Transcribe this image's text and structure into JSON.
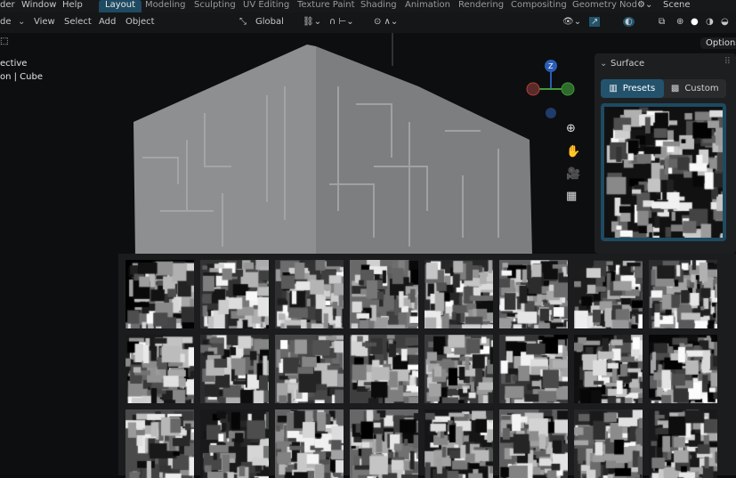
{
  "menu": [
    "der",
    "Window",
    "Help"
  ],
  "workspaces": [
    "Layout",
    "Modeling",
    "Sculpting",
    "UV Editing",
    "Texture Paint",
    "Shading",
    "Animation",
    "Rendering",
    "Compositing",
    "Geometry Nod"
  ],
  "active_workspace": "Layout",
  "scene_label": "Scene",
  "header": {
    "mode": "de",
    "items": [
      "View",
      "Select",
      "Add",
      "Object"
    ],
    "transform_orientation": "Global"
  },
  "viewport": {
    "line1": "ective",
    "line2": "on | Cube",
    "options_label": "Options",
    "gizmo_z": "Z"
  },
  "panel": {
    "title": "Surface",
    "tab_presets": "Presets",
    "tab_custom": "Custom",
    "active_tab": "Presets"
  },
  "colors": {
    "accent": "#1e4a62",
    "axis_z": "#2a5db5",
    "axis_x": "#b0403a",
    "axis_y": "#3e9a3a"
  }
}
